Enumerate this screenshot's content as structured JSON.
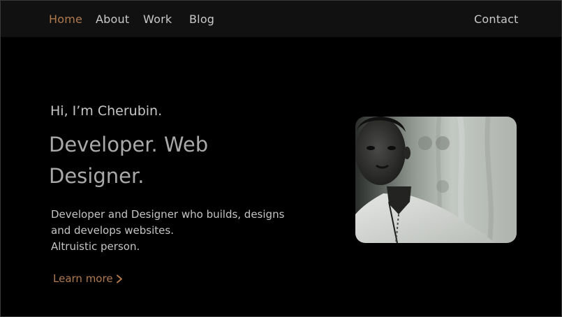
{
  "nav": {
    "items": [
      {
        "label": "Home",
        "active": true
      },
      {
        "label": "About",
        "active": false
      },
      {
        "label": "Work",
        "active": false
      },
      {
        "label": "Blog",
        "active": false
      }
    ],
    "contact_label": "Contact"
  },
  "hero": {
    "greeting": "Hi, I’m Cherubin.",
    "headline_line1": "Developer. Web",
    "headline_line2": "Designer.",
    "description_line1": "Developer and Designer who builds,  designs",
    "description_line2": "and  develops websites.",
    "description_line3": "Altruistic person.",
    "cta_label": "Learn more",
    "cta_icon": "chevron-right-icon"
  },
  "colors": {
    "background": "#000000",
    "navbar": "#111111",
    "accent": "#b07a4e",
    "text": "#c7c7c7"
  }
}
